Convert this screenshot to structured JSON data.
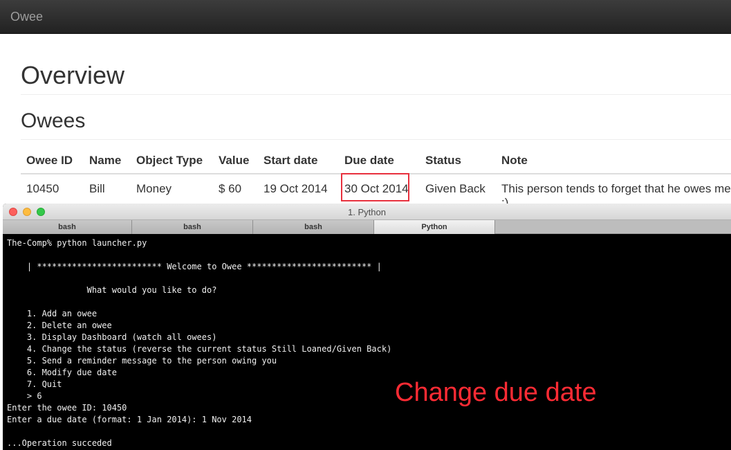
{
  "navbar": {
    "brand": "Owee"
  },
  "page": {
    "title": "Overview",
    "section_title": "Owees"
  },
  "table": {
    "headers": [
      "Owee ID",
      "Name",
      "Object Type",
      "Value",
      "Start date",
      "Due date",
      "Status",
      "Note"
    ],
    "rows": [
      [
        "10450",
        "Bill",
        "Money",
        "$ 60",
        "19 Oct 2014",
        "30 Oct 2014",
        "Given Back",
        "This person tends to forget that he owes me :)"
      ]
    ]
  },
  "terminal": {
    "window_title": "1. Python",
    "tabs": [
      "bash",
      "bash",
      "bash",
      "Python"
    ],
    "active_tab": 3,
    "lines": [
      "The-Comp% python launcher.py",
      "",
      "    | ************************* Welcome to Owee ************************* |",
      "",
      "                What would you like to do?",
      "",
      "    1. Add an owee",
      "    2. Delete an owee",
      "    3. Display Dashboard (watch all owees)",
      "    4. Change the status (reverse the current status Still Loaned/Given Back)",
      "    5. Send a reminder message to the person owing you",
      "    6. Modify due date",
      "    7. Quit",
      "    > 6",
      "Enter the owee ID: 10450",
      "Enter a due date (format: 1 Jan 2014): 1 Nov 2014",
      "",
      "...Operation succeded"
    ]
  },
  "annotation": {
    "text": "Change due date",
    "color": "#ff2b34"
  },
  "colors": {
    "highlight_border": "#e8303d",
    "navbar_bg": "#222222"
  }
}
